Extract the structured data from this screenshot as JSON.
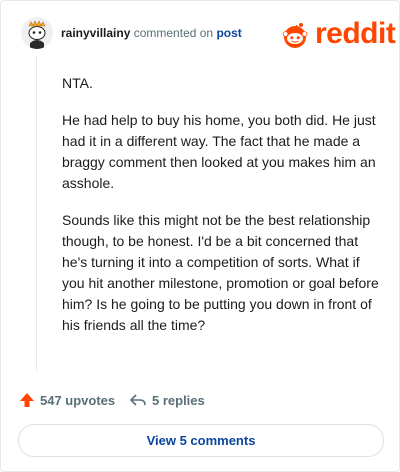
{
  "comment": {
    "username": "rainyvillainy",
    "action_text": "commented on",
    "target_link": "post",
    "avatar_icon": "snoo-avatar-icon",
    "paragraphs": [
      "NTA.",
      "He had help to buy his home, you both did. He just had it in a different way. The fact that he made a braggy comment then looked at you makes him an asshole.",
      "Sounds like this might not be the best relationship though, to be honest. I'd be a bit concerned that he's turning it into a competition of sorts. What if you hit another milestone, promotion or goal before him? Is he going to be putting you down in front of his friends all the time?"
    ]
  },
  "brand": {
    "name": "reddit",
    "color": "#ff4500"
  },
  "actions": {
    "upvotes_label": "547 upvotes",
    "replies_label": "5 replies",
    "upvote_color": "#ff4500"
  },
  "view_comments_label": "View 5 comments"
}
